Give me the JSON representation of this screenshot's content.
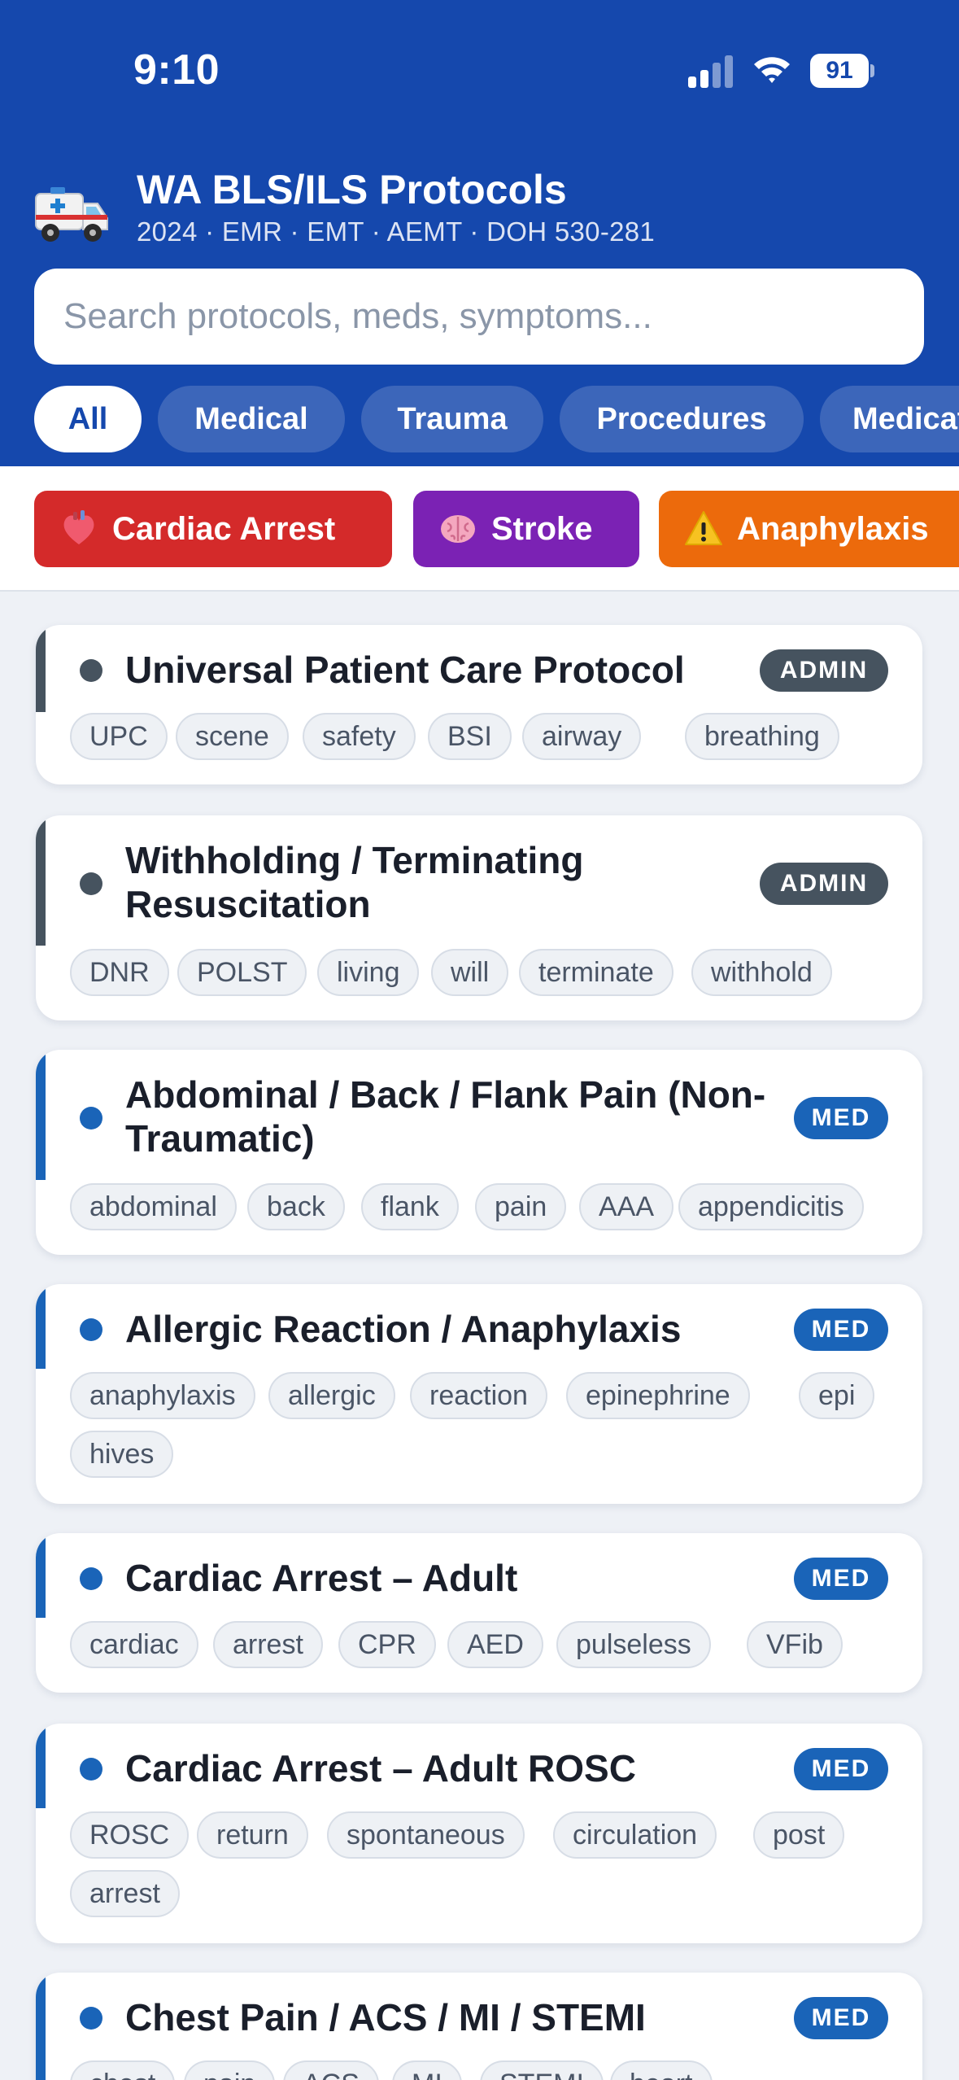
{
  "status_bar": {
    "time": "9:10",
    "battery": "91"
  },
  "header": {
    "app_icon": "ambulance-icon",
    "title": "WA BLS/ILS Protocols",
    "subtitle": "2024 · EMR · EMT · AEMT · DOH 530-281"
  },
  "search": {
    "placeholder": "Search protocols, meds, symptoms..."
  },
  "filters": [
    "All",
    "Medical",
    "Trauma",
    "Procedures",
    "Medications"
  ],
  "quick_access": [
    {
      "label": "Cardiac Arrest",
      "icon": "anatomical-heart-icon",
      "color": "#d42a2a"
    },
    {
      "label": "Stroke",
      "icon": "brain-icon",
      "color": "#7b22b4"
    },
    {
      "label": "Anaphylaxis",
      "icon": "warning-icon",
      "color": "#ec6a0c"
    }
  ],
  "colors": {
    "header": "#1548ad",
    "admin": "#46535f",
    "med": "#1a64b8"
  },
  "protocols": [
    {
      "title": "Universal Patient Care Protocol",
      "badge": "ADMIN",
      "tags": [
        "UPC",
        "scene",
        "safety",
        "BSI",
        "airway",
        "breathing"
      ]
    },
    {
      "title": "Withholding / Terminating Resuscitation",
      "badge": "ADMIN",
      "tags": [
        "DNR",
        "POLST",
        "living",
        "will",
        "terminate",
        "withhold"
      ]
    },
    {
      "title": "Abdominal / Back / Flank Pain (Non-Traumatic)",
      "badge": "MED",
      "tags": [
        "abdominal",
        "back",
        "flank",
        "pain",
        "AAA",
        "appendicitis"
      ]
    },
    {
      "title": "Allergic Reaction / Anaphylaxis",
      "badge": "MED",
      "tags": [
        "anaphylaxis",
        "allergic",
        "reaction",
        "epinephrine",
        "epi",
        "hives"
      ]
    },
    {
      "title": "Cardiac Arrest – Adult",
      "badge": "MED",
      "tags": [
        "cardiac",
        "arrest",
        "CPR",
        "AED",
        "pulseless",
        "VFib"
      ]
    },
    {
      "title": "Cardiac Arrest – Adult ROSC",
      "badge": "MED",
      "tags": [
        "ROSC",
        "return",
        "spontaneous",
        "circulation",
        "post",
        "arrest"
      ]
    },
    {
      "title": "Chest Pain / ACS / MI / STEMI",
      "badge": "MED",
      "tags": [
        "chest",
        "pain",
        "ACS",
        "MI",
        "STEMI",
        "heart"
      ]
    }
  ]
}
